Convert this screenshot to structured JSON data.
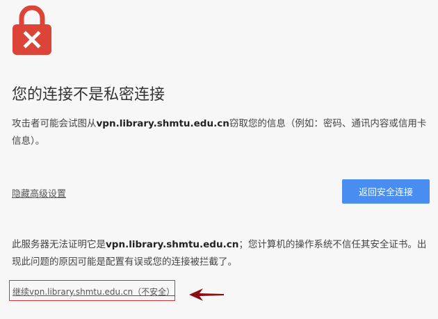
{
  "heading": {
    "title": "您的连接不是私密连接"
  },
  "description": {
    "prefix": "攻击者可能会试图从",
    "host": "vpn.library.shmtu.edu.cn",
    "suffix": "窃取您的信息（例如：密码、通讯内容或信用卡信息）。"
  },
  "actions": {
    "advanced_label": "隐藏高级设置",
    "back_label": "返回安全连接"
  },
  "details": {
    "prefix": "此服务器无法证明它是",
    "host": "vpn.library.shmtu.edu.cn",
    "suffix": "；您计算机的操作系统不信任其安全证书。出现此问题的原因可能是配置有误或您的连接被拦截了。",
    "proceed_label": "继续vpn.library.shmtu.edu.cn（不安全）"
  },
  "icons": {
    "lock": "lock-error-icon",
    "arrow": "arrow-left-icon"
  },
  "colors": {
    "lock": "#db4437",
    "button": "#4a8df0",
    "highlight": "#d9302b",
    "arrow": "#8b0f12"
  }
}
